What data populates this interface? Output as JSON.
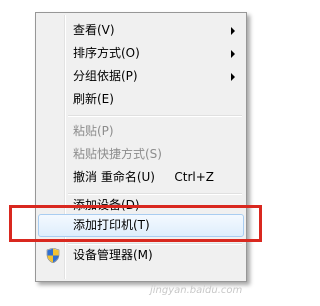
{
  "menu": {
    "items": [
      {
        "label": "查看(V)",
        "submenu": true
      },
      {
        "label": "排序方式(O)",
        "submenu": true
      },
      {
        "label": "分组依据(P)",
        "submenu": true
      },
      {
        "label": "刷新(E)"
      },
      {
        "label": "粘贴(P)",
        "disabled": true
      },
      {
        "label": "粘贴快捷方式(S)",
        "disabled": true
      },
      {
        "label": "撤消 重命名(U)",
        "shortcut": "Ctrl+Z"
      },
      {
        "label": "添加设备(D)"
      },
      {
        "label": "添加打印机(T)",
        "highlighted": true
      },
      {
        "label": "设备管理器(M)",
        "icon": "uac-shield-icon"
      }
    ]
  },
  "annotation": {
    "color": "#d9281f"
  },
  "watermark": "jingyan.baidu.com"
}
